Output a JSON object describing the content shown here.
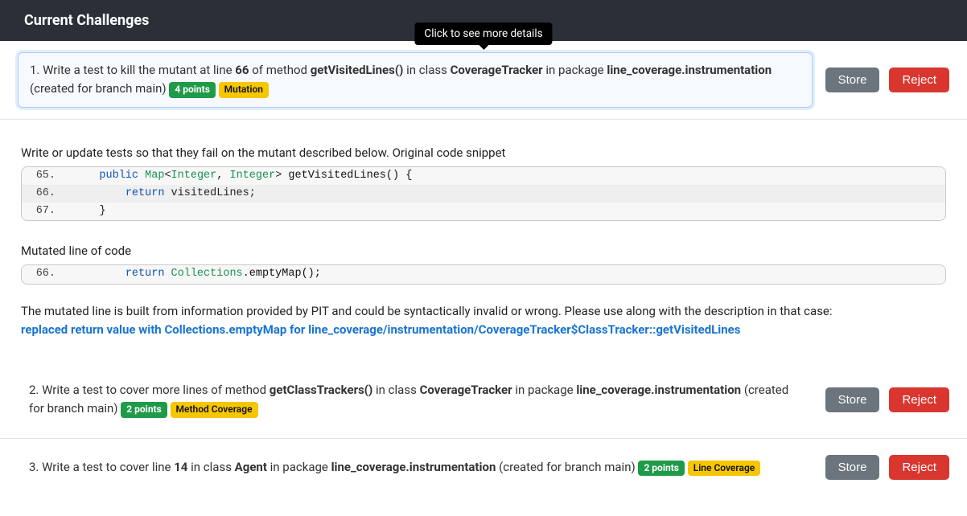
{
  "header": {
    "title": "Current Challenges"
  },
  "tooltip": "Click to see more details",
  "buttons": {
    "store": "Store",
    "reject": "Reject"
  },
  "challenges": [
    {
      "prefix": "1. Write a test to kill the mutant at line ",
      "line": "66",
      "mid1": " of method ",
      "method": "getVisitedLines()",
      "mid2": " in class ",
      "class": "CoverageTracker",
      "mid3": " in package ",
      "package": "line_coverage.instrumentation",
      "suffix": " (created for branch main)",
      "points": "4 points",
      "tag": "Mutation"
    },
    {
      "prefix": "2. Write a test to cover more lines of method ",
      "method": "getClassTrackers()",
      "mid2": " in class ",
      "class": "CoverageTracker",
      "mid3": " in package ",
      "package": "line_coverage.instrumentation",
      "suffix": " (created for branch main)",
      "points": "2 points",
      "tag": "Method Coverage"
    },
    {
      "prefix": "3. Write a test to cover line ",
      "line": "14",
      "mid2": " in class ",
      "class": "Agent",
      "mid3": " in package ",
      "package": "line_coverage.instrumentation",
      "suffix": " (created for branch main)",
      "points": "2 points",
      "tag": "Line Coverage"
    }
  ],
  "detail": {
    "intro": "Write or update tests so that they fail on the mutant described below. Original code snippet",
    "original": [
      {
        "ln": "65.",
        "kw1": "public",
        "sp": " ",
        "t1": "Map",
        "g1": "<",
        "t2": "Integer",
        "c": ", ",
        "t3": "Integer",
        "g2": "> ",
        "m": "getVisitedLines",
        "p": "() {"
      },
      {
        "ln": "66.",
        "kw1": "return",
        "sp": " ",
        "rest": "visitedLines;"
      },
      {
        "ln": "67.",
        "rest": "}"
      }
    ],
    "mutated_heading": "Mutated line of code",
    "mutated": {
      "ln": "66.",
      "kw1": "return",
      "sp": " ",
      "t1": "Collections",
      "dot": ".",
      "m": "emptyMap",
      "p": "();"
    },
    "pit_note": "The mutated line is built from information provided by PIT and could be syntactically invalid or wrong. Please use along with the description in that case: ",
    "pit_link": "replaced return value with Collections.emptyMap for line_coverage/instrumentation/CoverageTracker$ClassTracker::getVisitedLines"
  }
}
